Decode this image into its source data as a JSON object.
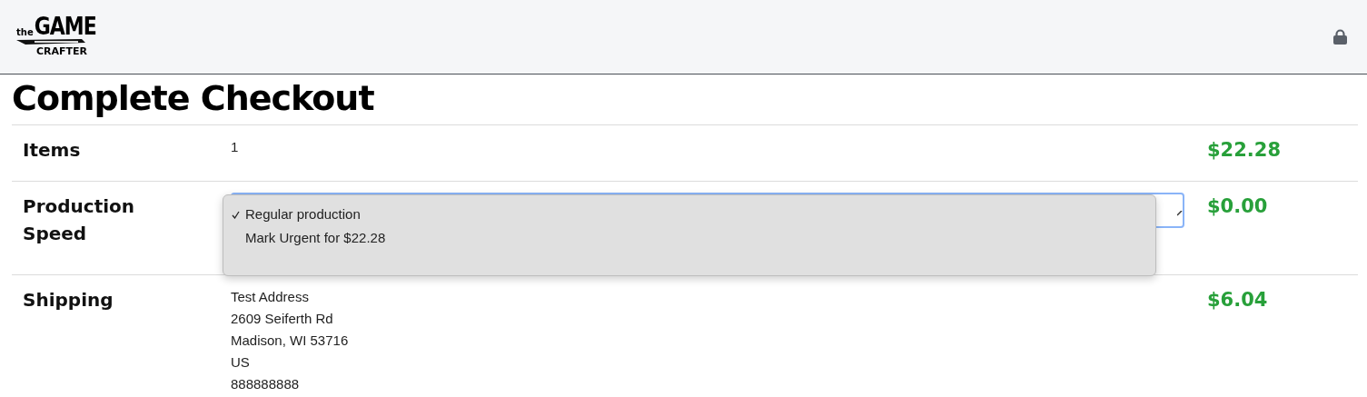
{
  "header": {
    "logo": {
      "top": "the",
      "main": "GAME",
      "bottom": "CRAFTER"
    }
  },
  "title": "Complete Checkout",
  "rows": [
    {
      "kind": "text",
      "label": "Items",
      "value": "1",
      "price": "$22.28"
    },
    {
      "kind": "select",
      "label": "Production Speed",
      "options": [
        {
          "label": "Regular production",
          "selected": true
        },
        {
          "label": "Mark Urgent for $22.28",
          "selected": false
        }
      ],
      "price": "$0.00"
    },
    {
      "kind": "address",
      "label": "Shipping",
      "lines": [
        "Test Address",
        "2609 Seiferth Rd",
        "Madison, WI 53716",
        "US",
        "888888888"
      ],
      "price": "$6.04"
    }
  ]
}
